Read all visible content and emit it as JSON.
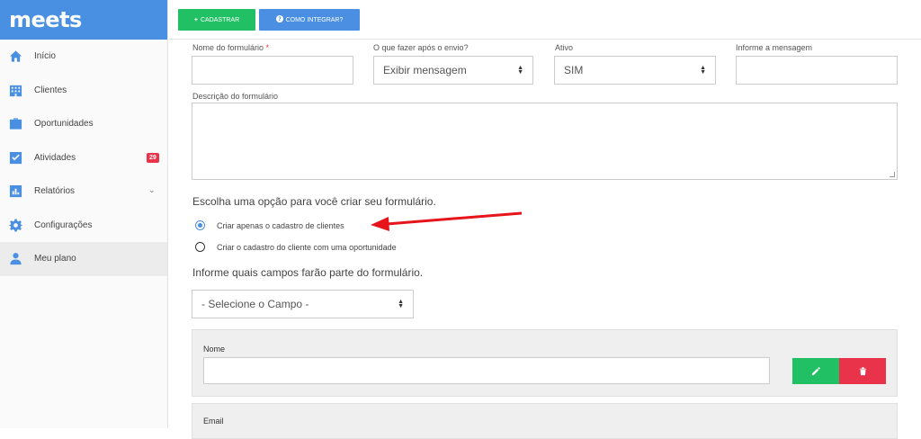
{
  "brand": {
    "name": "meets"
  },
  "sidebar": {
    "items": [
      {
        "label": "Início",
        "icon": "home-icon"
      },
      {
        "label": "Clientes",
        "icon": "building-icon"
      },
      {
        "label": "Oportunidades",
        "icon": "briefcase-icon"
      },
      {
        "label": "Atividades",
        "icon": "checkbox-icon",
        "badge": "29"
      },
      {
        "label": "Relatórios",
        "icon": "bar-chart-icon"
      },
      {
        "label": "Configurações",
        "icon": "gear-icon"
      },
      {
        "label": "Meu plano",
        "icon": "user-icon"
      }
    ]
  },
  "topbar": {
    "register_label": "CADASTRAR",
    "integrate_label": "COMO INTEGRAR?"
  },
  "form": {
    "name_label": "Nome do formulário",
    "required_mark": "*",
    "after_send_label": "O que fazer após o envio?",
    "after_send_value": "Exibir mensagem",
    "active_label": "Ativo",
    "active_value": "SIM",
    "message_label": "Informe a mensagem",
    "description_label": "Descrição do formulário",
    "choose_heading": "Escolha uma opção para você criar seu formulário.",
    "option_1": "Criar apenas o cadastro de clientes",
    "option_2": "Criar o cadastro do cliente com uma oportunidade",
    "fields_heading": "Informe quais campos farão parte do formulário.",
    "field_select_value": "- Selecione o Campo -",
    "cards": [
      {
        "label": "Nome"
      },
      {
        "label": "Email"
      }
    ]
  },
  "colors": {
    "accent": "#4a90e2",
    "green": "#21c064",
    "red": "#e8334a",
    "arrow": "#e8141c"
  }
}
